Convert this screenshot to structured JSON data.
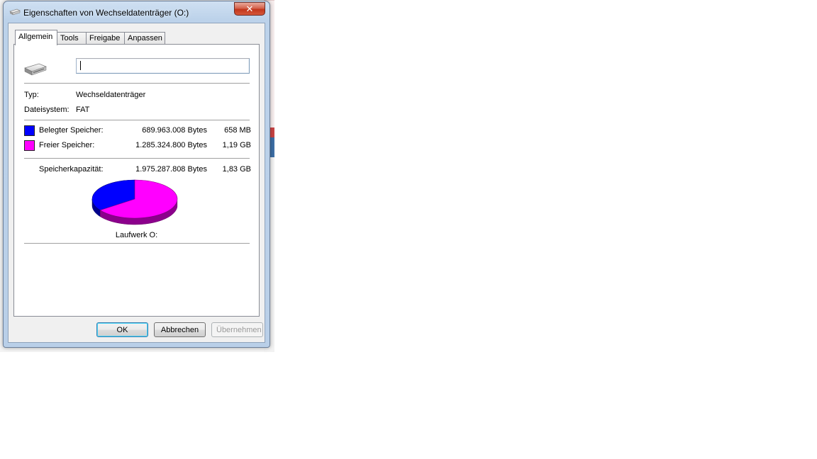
{
  "window": {
    "title": "Eigenschaften von Wechseldatenträger (O:)",
    "close_symbol": "✕"
  },
  "tabs": [
    {
      "label": "Allgemein",
      "active": true
    },
    {
      "label": "Tools",
      "active": false
    },
    {
      "label": "Freigabe",
      "active": false
    },
    {
      "label": "Anpassen",
      "active": false
    }
  ],
  "general": {
    "drive_name_value": "",
    "type_label": "Typ:",
    "type_value": "Wechseldatenträger",
    "filesystem_label": "Dateisystem:",
    "filesystem_value": "FAT",
    "used": {
      "label": "Belegter Speicher:",
      "bytes": "689.963.008 Bytes",
      "size": "658 MB",
      "color": "#0000ff"
    },
    "free": {
      "label": "Freier Speicher:",
      "bytes": "1.285.324.800 Bytes",
      "size": "1,19 GB",
      "color": "#ff00ff"
    },
    "capacity": {
      "label": "Speicherkapazität:",
      "bytes": "1.975.287.808 Bytes",
      "size": "1,83 GB"
    },
    "drive_caption": "Laufwerk O:"
  },
  "chart_data": {
    "type": "pie",
    "slices": [
      {
        "name": "Belegter Speicher",
        "value": 689963008,
        "color": "#0000ff"
      },
      {
        "name": "Freier Speicher",
        "value": 1285324800,
        "color": "#ff00ff"
      }
    ]
  },
  "buttons": {
    "ok": "OK",
    "cancel": "Abbrechen",
    "apply": "Übernehmen"
  },
  "icons": {
    "title": "drive-icon",
    "drive": "usb-drive-icon"
  }
}
